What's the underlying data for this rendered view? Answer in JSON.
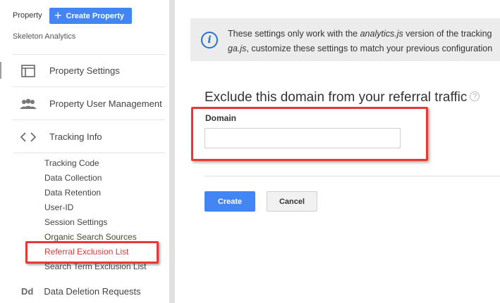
{
  "sidebar": {
    "property_label": "Property",
    "create_property_label": "Create Property",
    "account_name": "Skeleton Analytics",
    "nav": [
      {
        "label": "Property Settings",
        "icon": "window-icon"
      },
      {
        "label": "Property User Management",
        "icon": "people-icon"
      },
      {
        "label": "Tracking Info",
        "icon": "code-icon"
      }
    ],
    "tracking_sub_items": [
      {
        "label": "Tracking Code"
      },
      {
        "label": "Data Collection"
      },
      {
        "label": "Data Retention"
      },
      {
        "label": "User-ID"
      },
      {
        "label": "Session Settings"
      },
      {
        "label": "Organic Search Sources"
      },
      {
        "label": "Referral Exclusion List"
      },
      {
        "label": "Search Term Exclusion List"
      }
    ],
    "data_deletion": {
      "icon_text": "Dd",
      "label": "Data Deletion Requests"
    }
  },
  "info": {
    "line1_pre": "These settings only work with the ",
    "line1_em": "analytics.js",
    "line1_post": " version of the tracking",
    "line2_em": "ga.js",
    "line2_post": ", customize these settings to match your previous configuration"
  },
  "form": {
    "heading": "Exclude this domain from your referral traffic",
    "help_icon": "?",
    "domain_label": "Domain",
    "domain_value": "",
    "domain_placeholder": "",
    "create_label": "Create",
    "cancel_label": "Cancel"
  },
  "colors": {
    "accent": "#4285f4",
    "highlight": "#e53935",
    "active_text": "#d93a3a",
    "info_icon": "#2a72c8"
  }
}
